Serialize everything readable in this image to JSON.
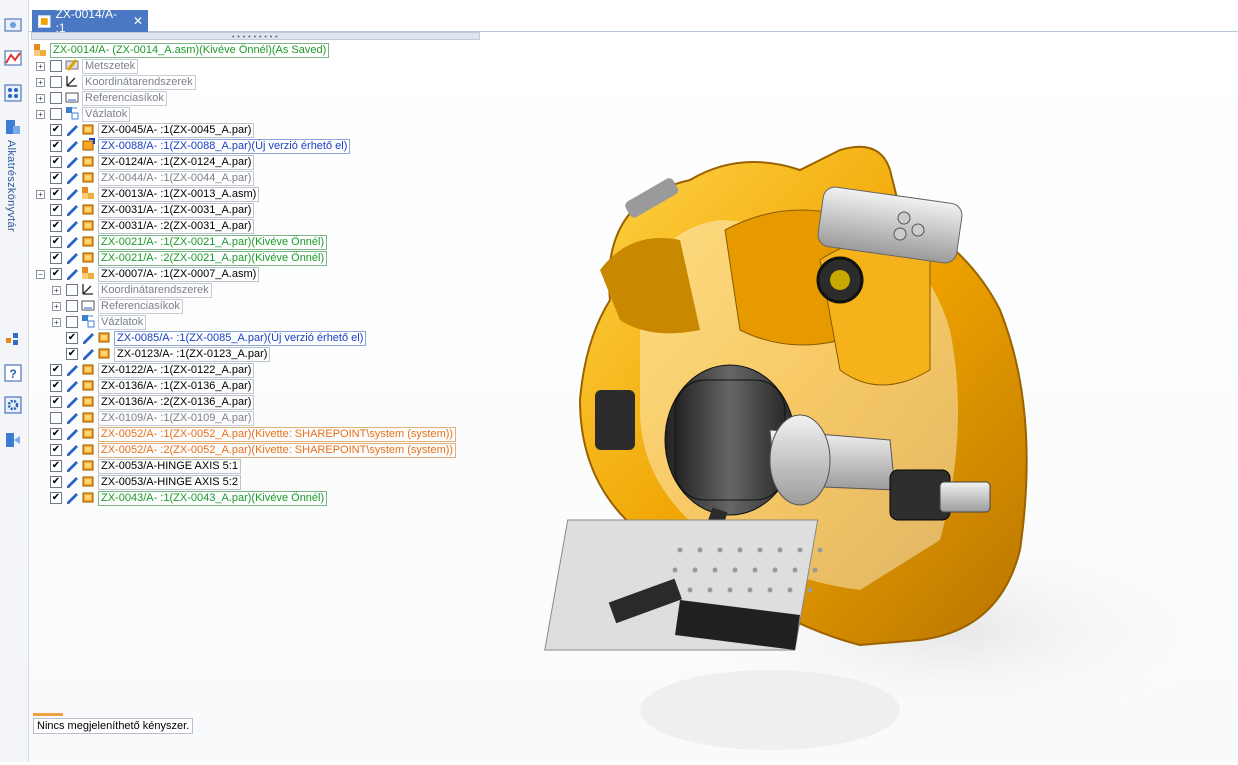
{
  "toolbar": {
    "vertical_label": "Alkatrészkönyvtár",
    "icons": [
      "display-panel-icon",
      "color-palette-icon",
      "layers-icon",
      "parts-library-icon",
      "feature-tree-icon",
      "help-icon",
      "settings-icon",
      "export-icon"
    ]
  },
  "tab": {
    "title": "ZX-0014/A- :1",
    "close": "✕"
  },
  "tree": {
    "root": "ZX-0014/A- (ZX-0014_A.asm)(Kivéve Önnél)(As Saved)",
    "items": [
      {
        "label": "Metszetek",
        "color": "gray",
        "checked": false,
        "expand": "+",
        "icon": "section-icon",
        "level": 1,
        "pencil": false
      },
      {
        "label": "Koordinátarendszerek",
        "color": "gray",
        "checked": false,
        "expand": "+",
        "icon": "coordinate-system-icon",
        "level": 1,
        "pencil": false
      },
      {
        "label": "Referenciasíkok",
        "color": "gray",
        "checked": false,
        "expand": "+",
        "icon": "reference-plane-icon",
        "level": 1,
        "pencil": false
      },
      {
        "label": "Vázlatok",
        "color": "gray",
        "checked": false,
        "expand": "+",
        "icon": "sketch-icon",
        "level": 1,
        "pencil": false
      },
      {
        "label": "ZX-0045/A- :1(ZX-0045_A.par)",
        "color": "black",
        "checked": true,
        "expand": "",
        "icon": "part-icon",
        "level": 1,
        "pencil": true
      },
      {
        "label": "ZX-0088/A- :1(ZX-0088_A.par)(Új verzió érhető el)",
        "color": "blue",
        "checked": true,
        "expand": "",
        "icon": "part-update-icon",
        "level": 1,
        "pencil": true
      },
      {
        "label": "ZX-0124/A- :1(ZX-0124_A.par)",
        "color": "black",
        "checked": true,
        "expand": "",
        "icon": "part-icon",
        "level": 1,
        "pencil": true
      },
      {
        "label": "ZX-0044/A- :1(ZX-0044_A.par)",
        "color": "gray",
        "checked": true,
        "expand": "",
        "icon": "part-icon",
        "level": 1,
        "pencil": true
      },
      {
        "label": "ZX-0013/A- :1(ZX-0013_A.asm)",
        "color": "black",
        "checked": true,
        "expand": "+",
        "icon": "assembly-icon",
        "level": 1,
        "pencil": true
      },
      {
        "label": "ZX-0031/A- :1(ZX-0031_A.par)",
        "color": "black",
        "checked": true,
        "expand": "",
        "icon": "part-icon",
        "level": 1,
        "pencil": true
      },
      {
        "label": "ZX-0031/A- :2(ZX-0031_A.par)",
        "color": "black",
        "checked": true,
        "expand": "",
        "icon": "part-icon",
        "level": 1,
        "pencil": true
      },
      {
        "label": "ZX-0021/A- :1(ZX-0021_A.par)(Kivéve Önnél)",
        "color": "green",
        "checked": true,
        "expand": "",
        "icon": "part-icon",
        "level": 1,
        "pencil": true
      },
      {
        "label": "ZX-0021/A- :2(ZX-0021_A.par)(Kivéve Önnél)",
        "color": "green",
        "checked": true,
        "expand": "",
        "icon": "part-icon",
        "level": 1,
        "pencil": true
      },
      {
        "label": "ZX-0007/A- :1(ZX-0007_A.asm)",
        "color": "black",
        "checked": true,
        "expand": "−",
        "icon": "assembly-icon",
        "level": 1,
        "pencil": true
      },
      {
        "label": "Koordinátarendszerek",
        "color": "gray",
        "checked": false,
        "expand": "+",
        "icon": "coordinate-system-icon",
        "level": 2,
        "pencil": false
      },
      {
        "label": "Referenciasíkok",
        "color": "gray",
        "checked": false,
        "expand": "+",
        "icon": "reference-plane-icon",
        "level": 2,
        "pencil": false
      },
      {
        "label": "Vázlatok",
        "color": "gray",
        "checked": false,
        "expand": "+",
        "icon": "sketch-icon",
        "level": 2,
        "pencil": false
      },
      {
        "label": "ZX-0085/A- :1(ZX-0085_A.par)(Új verzió érhető el)",
        "color": "blue",
        "checked": true,
        "expand": "",
        "icon": "part-icon",
        "level": 2,
        "pencil": true
      },
      {
        "label": "ZX-0123/A- :1(ZX-0123_A.par)",
        "color": "black",
        "checked": true,
        "expand": "",
        "icon": "part-icon",
        "level": 2,
        "pencil": true
      },
      {
        "label": "ZX-0122/A- :1(ZX-0122_A.par)",
        "color": "black",
        "checked": true,
        "expand": "",
        "icon": "part-icon",
        "level": 1,
        "pencil": true
      },
      {
        "label": "ZX-0136/A- :1(ZX-0136_A.par)",
        "color": "black",
        "checked": true,
        "expand": "",
        "icon": "part-icon",
        "level": 1,
        "pencil": true
      },
      {
        "label": "ZX-0136/A- :2(ZX-0136_A.par)",
        "color": "black",
        "checked": true,
        "expand": "",
        "icon": "part-icon",
        "level": 1,
        "pencil": true
      },
      {
        "label": "ZX-0109/A- :1(ZX-0109_A.par)",
        "color": "gray",
        "checked": false,
        "expand": "",
        "icon": "part-icon",
        "level": 1,
        "pencil": true
      },
      {
        "label": "ZX-0052/A- :1(ZX-0052_A.par)(Kivette: SHAREPOINT\\system (system))",
        "color": "orange",
        "checked": true,
        "expand": "",
        "icon": "part-icon",
        "level": 1,
        "pencil": true
      },
      {
        "label": "ZX-0052/A- :2(ZX-0052_A.par)(Kivette: SHAREPOINT\\system (system))",
        "color": "orange",
        "checked": true,
        "expand": "",
        "icon": "part-icon",
        "level": 1,
        "pencil": true
      },
      {
        "label": "ZX-0053/A-HINGE AXIS 5:1",
        "color": "black",
        "checked": true,
        "expand": "",
        "icon": "part-icon",
        "level": 1,
        "pencil": true
      },
      {
        "label": "ZX-0053/A-HINGE AXIS 5:2",
        "color": "black",
        "checked": true,
        "expand": "",
        "icon": "part-icon",
        "level": 1,
        "pencil": true
      },
      {
        "label": "ZX-0043/A- :1(ZX-0043_A.par)(Kivéve Önnél)",
        "color": "green",
        "checked": true,
        "expand": "",
        "icon": "part-icon",
        "level": 1,
        "pencil": true
      }
    ]
  },
  "status": {
    "constraints": "Nincs megjeleníthető kényszer."
  },
  "colors": {
    "tab_active": "#4a78c2",
    "model_orange": "#f0a400",
    "model_dark": "#3d3d3d"
  }
}
